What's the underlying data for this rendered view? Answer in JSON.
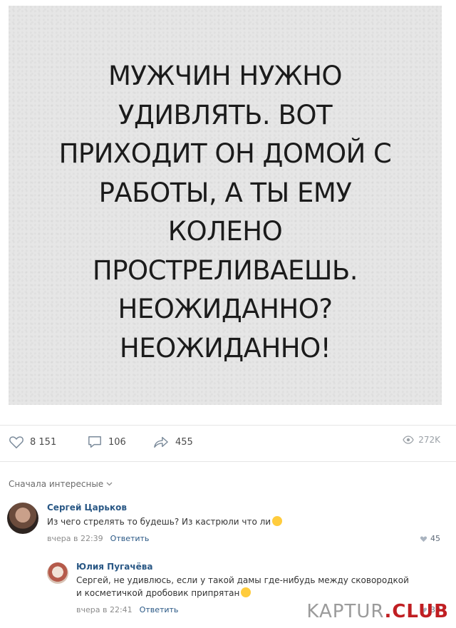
{
  "poster": {
    "lines": [
      "МУЖЧИН НУЖНО",
      "УДИВЛЯТЬ. ВОТ",
      "ПРИХОДИТ ОН ДОМОЙ С",
      "РАБОТЫ, А ТЫ ЕМУ",
      "КОЛЕНО",
      "ПРОСТРЕЛИВАЕШЬ.",
      "НЕОЖИДАННО?",
      "НЕОЖИДАННО!"
    ]
  },
  "actions": {
    "likes": "8 151",
    "comments": "106",
    "shares": "455",
    "views": "272K"
  },
  "sort_label": "Сначала интересные",
  "comments": [
    {
      "author": "Сергей Царьков",
      "text": "Из чего стрелять то будешь? Из кастрюли что ли",
      "time": "вчера в 22:39",
      "reply_label": "Ответить",
      "likes": "45"
    },
    {
      "author": "Юлия Пугачёва",
      "text": "Сергей, не удивлюсь, если у такой дамы где-нибудь между сковородкой и косметичкой дробовик припрятан",
      "time": "вчера в 22:41",
      "reply_label": "Ответить",
      "likes": "30"
    }
  ],
  "watermark": {
    "part1": "KAPTUR",
    "part2": ".CLUB"
  }
}
